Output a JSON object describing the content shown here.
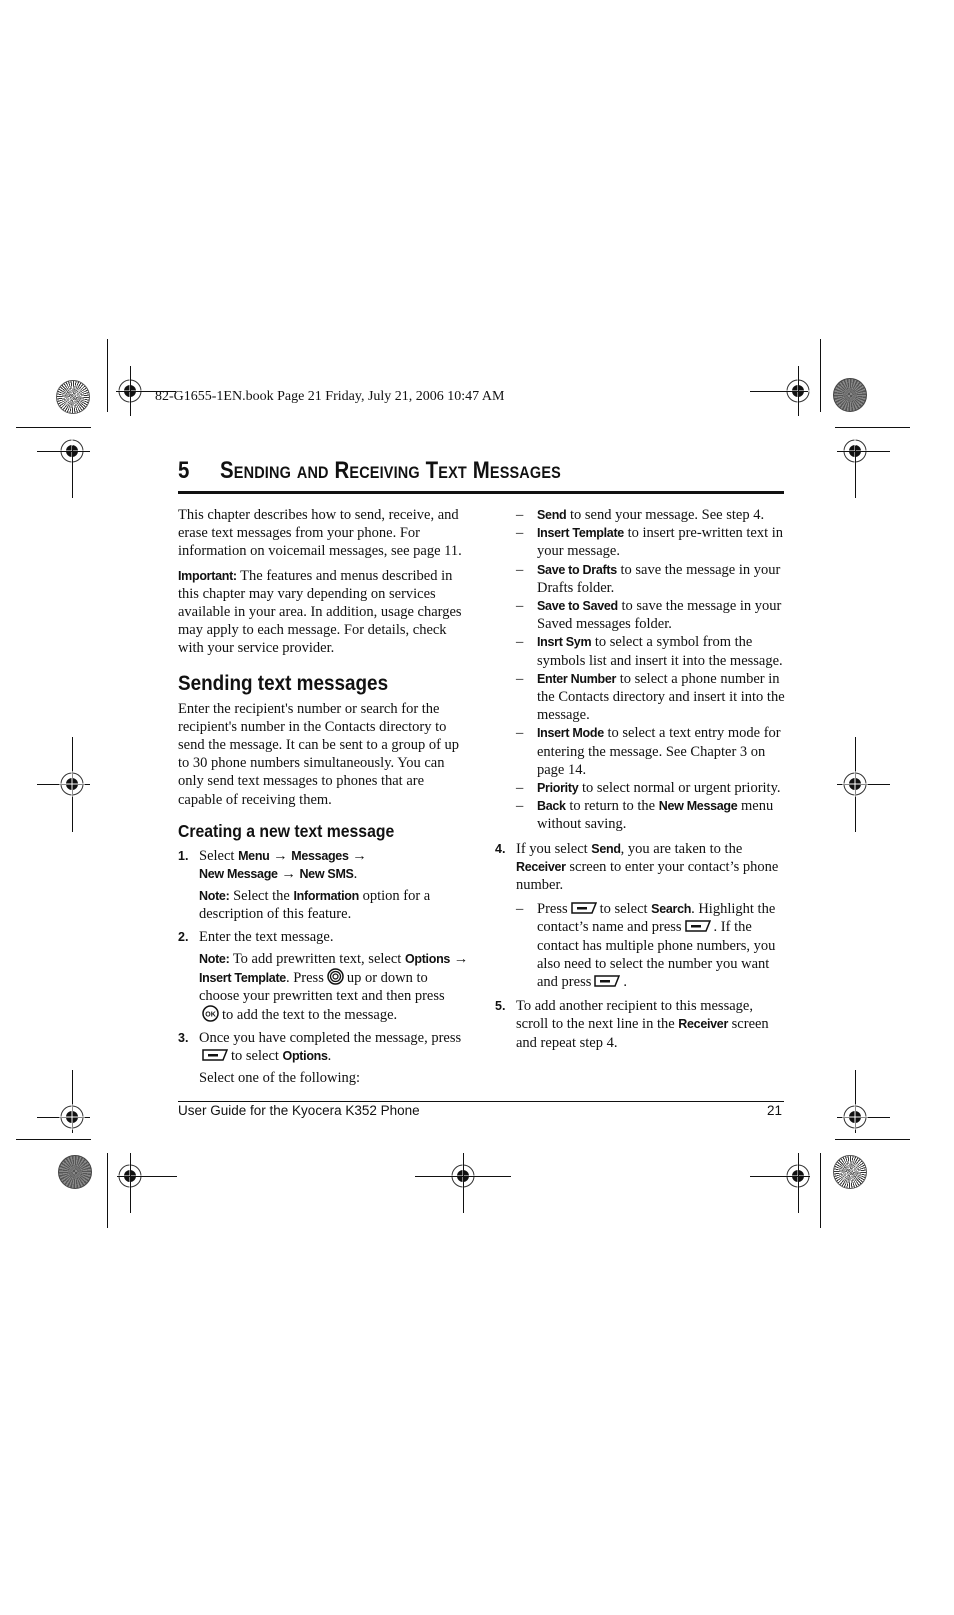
{
  "slug": "82-G1655-1EN.book  Page 21  Friday, July 21, 2006  10:47 AM",
  "chapter": {
    "number": "5",
    "title": "Sending and Receiving Text Messages"
  },
  "intro": {
    "paragraph": "This chapter describes how to send, receive, and erase text messages from your phone. For information on voicemail messages, see page 11.",
    "important_label": "Important:",
    "important_text": " The features and menus described in this chapter may vary depending on services available in your area. In addition, usage charges may apply to each message. For details, check with your service provider."
  },
  "section": {
    "title": "Sending text messages",
    "body": "Enter the recipient's number or search for the recipient's number in the Contacts directory to send the message. It can be sent to a group of up to 30 phone numbers simultaneously. You can only send text messages to phones that are capable of receiving them."
  },
  "subsection": {
    "title": "Creating a new text message"
  },
  "steps": {
    "s1": {
      "num": "1.",
      "t1": "Select ",
      "menu": "Menu",
      "arrow": " → ",
      "messages": "Messages",
      "new_message": "New Message",
      "new_sms": "New SMS",
      "end": ".",
      "note_label": "Note:",
      "note_t1": " Select the ",
      "note_info": "Information",
      "note_t2": " option for a description of this feature."
    },
    "s2": {
      "num": "2.",
      "text": "Enter the text message.",
      "note_label": "Note:",
      "note_t1": " To add prewritten text, select ",
      "options": "Options",
      "arrow": " → ",
      "insert_template": "Insert Template",
      "note_t2": ". Press",
      "note_t3": "up or down to choose your prewritten text and then press",
      "note_t4": "to add the text to the message."
    },
    "s3": {
      "num": "3.",
      "t1": "Once you have completed the message, press",
      "t2": "to select ",
      "options": "Options",
      "end": ".",
      "follow": "Select one of the following:"
    },
    "options_list": [
      {
        "label": "Send",
        "text": " to send your message. See step 4."
      },
      {
        "label": "Insert Template",
        "text": " to insert pre-written text in your message."
      },
      {
        "label": "Save to Drafts",
        "text": " to save the message in your Drafts folder."
      },
      {
        "label": "Save to Saved",
        "text": " to save the message in your Saved messages folder."
      },
      {
        "label": "Insrt Sym",
        "text": " to select a symbol from the symbols list and insert it into the message."
      },
      {
        "label": "Enter Number",
        "text": " to select a phone number in the Contacts directory and insert it into the message."
      },
      {
        "label": "Insert Mode",
        "text": " to select a text entry mode for entering the message. See Chapter 3 on page 14."
      },
      {
        "label": "Priority",
        "text": " to select normal or urgent priority."
      },
      {
        "label": "Back",
        "text": " to return to the ",
        "label2": "New Message",
        "text2": " menu without saving."
      }
    ],
    "dash": "–",
    "s4": {
      "num": "4.",
      "t1": "If you select ",
      "send": "Send",
      "t2": ", you are taken to the ",
      "receiver": "Receiver",
      "t3": " screen to enter your contact’s phone number.",
      "sub_t1": "Press",
      "sub_t2": "to select ",
      "search": "Search",
      "sub_t3": ". Highlight the contact’s name and press",
      "sub_t4": ". If the contact has multiple phone numbers, you also need to select the number you want and press",
      "sub_t5": "."
    },
    "s5": {
      "num": "5.",
      "t1": "To add another recipient to this message, scroll to the next line in the ",
      "receiver": "Receiver",
      "t2": " screen and repeat step 4."
    }
  },
  "icons": {
    "softkey": "left-softkey-icon",
    "navigation": "navigation-key-icon",
    "ok": "ok-key-icon"
  },
  "footer": {
    "left": "User Guide for the Kyocera K352 Phone",
    "page_number": "21"
  }
}
